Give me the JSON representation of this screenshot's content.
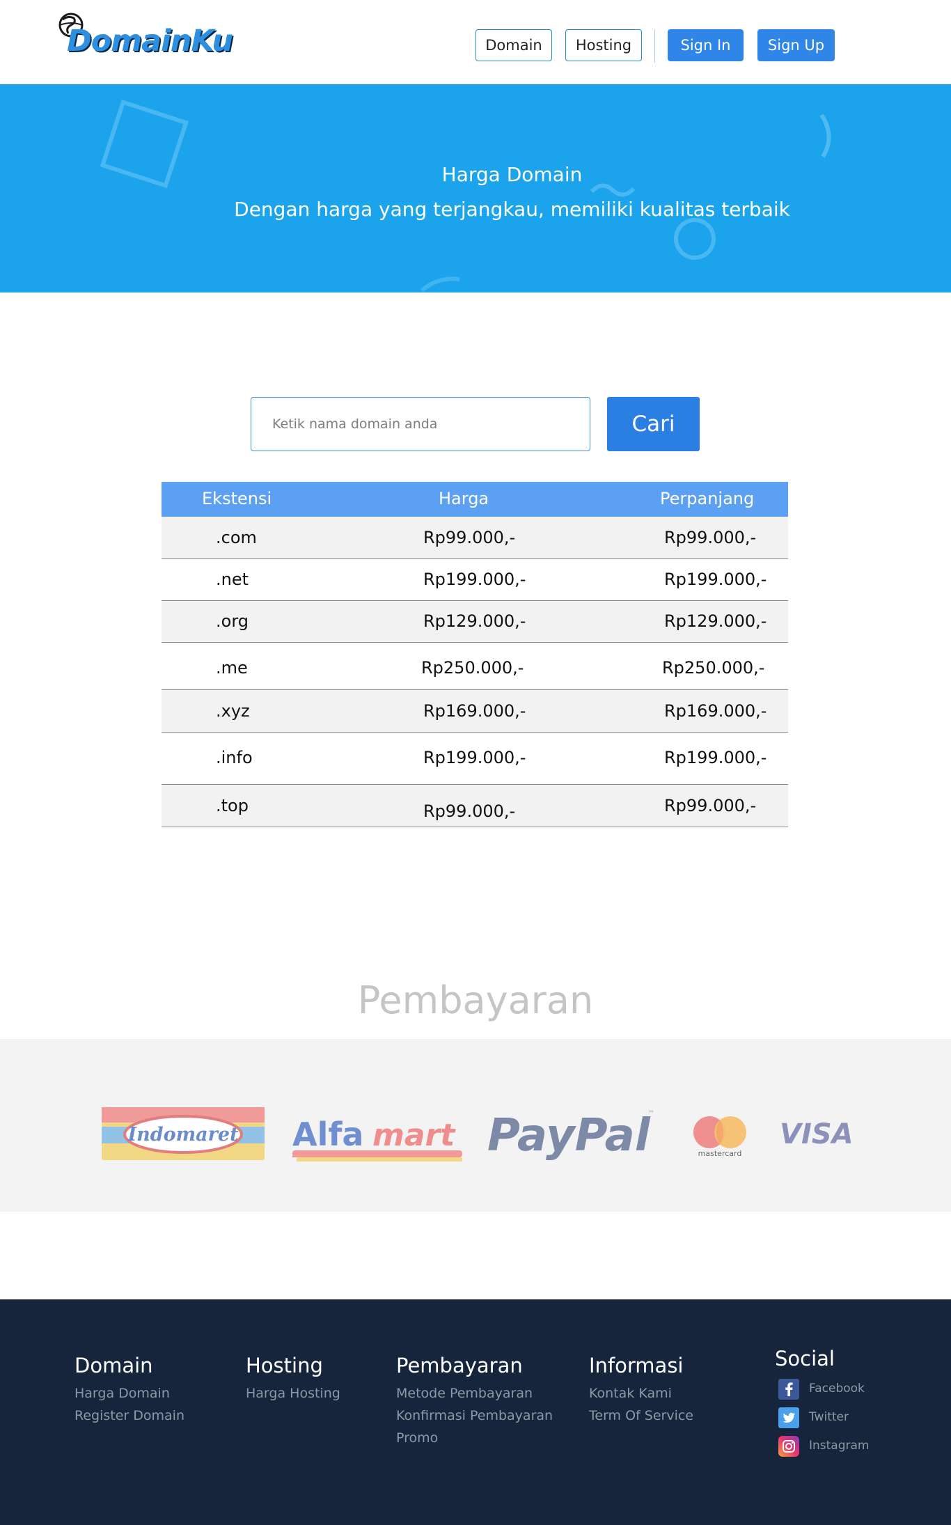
{
  "brand": {
    "logo_text": "DomainKu"
  },
  "nav": {
    "domain": "Domain",
    "hosting": "Hosting",
    "signin": "Sign In",
    "signup": "Sign Up"
  },
  "hero": {
    "title": "Harga Domain",
    "subtitle": "Dengan harga yang terjangkau, memiliki kualitas terbaik"
  },
  "search": {
    "placeholder": "Ketik nama domain anda",
    "button": "Cari"
  },
  "table": {
    "headers": [
      "Ekstensi",
      "Harga",
      "Perpanjang"
    ],
    "rows": [
      {
        "ext": ".com",
        "price": "Rp99.000,-",
        "renew": "Rp99.000,-"
      },
      {
        "ext": ".net",
        "price": "Rp199.000,-",
        "renew": "Rp199.000,-"
      },
      {
        "ext": ".org",
        "price": "Rp129.000,-",
        "renew": "Rp129.000,-"
      },
      {
        "ext": ".me",
        "price": "Rp250.000,-",
        "renew": "Rp250.000,-"
      },
      {
        "ext": ".xyz",
        "price": "Rp169.000,-",
        "renew": "Rp169.000,-"
      },
      {
        "ext": ".info",
        "price": "Rp199.000,-",
        "renew": "Rp199.000,-"
      },
      {
        "ext": ".top",
        "price": "Rp99.000,-",
        "renew": "Rp99.000,-"
      }
    ]
  },
  "payment": {
    "title": "Pembayaran",
    "logos": {
      "indomaret": "Indomaret",
      "alfamart_a": "Alfa",
      "alfamart_b": "mart",
      "paypal": "PayPal",
      "mastercard": "mastercard",
      "visa": "VISA"
    }
  },
  "footer": {
    "domain": {
      "title": "Domain",
      "links": [
        "Harga Domain",
        "Register Domain"
      ]
    },
    "hosting": {
      "title": "Hosting",
      "links": [
        "Harga Hosting"
      ]
    },
    "pembayaran": {
      "title": "Pembayaran",
      "links": [
        "Metode Pembayaran",
        "Konfirmasi Pembayaran",
        "Promo"
      ]
    },
    "informasi": {
      "title": "Informasi",
      "links": [
        "Kontak Kami",
        "Term Of Service"
      ]
    },
    "social": {
      "title": "Social",
      "links": [
        "Facebook",
        "Twitter",
        "Instagram"
      ]
    }
  },
  "colors": {
    "hero_bg": "#1ba3ec",
    "primary_button": "#2f86e8",
    "table_header": "#5ba0f2",
    "footer_bg": "#17253c"
  }
}
